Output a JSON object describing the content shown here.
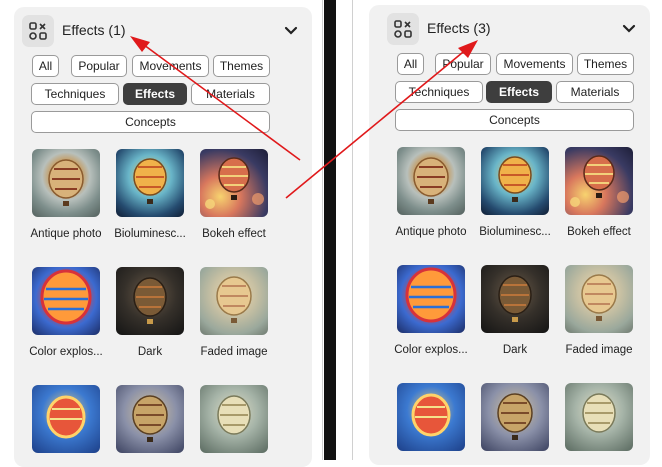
{
  "left_panel": {
    "title": "Effects (1)",
    "filters": [
      {
        "label": "All",
        "selected": false
      },
      {
        "label": "Popular",
        "selected": false
      },
      {
        "label": "Movements",
        "selected": false
      },
      {
        "label": "Themes",
        "selected": false
      },
      {
        "label": "Techniques",
        "selected": false
      },
      {
        "label": "Effects",
        "selected": true
      },
      {
        "label": "Materials",
        "selected": false
      },
      {
        "label": "Concepts",
        "selected": false
      }
    ],
    "items": [
      {
        "label": "Antique photo"
      },
      {
        "label": "Bioluminesc..."
      },
      {
        "label": "Bokeh effect"
      },
      {
        "label": "Color explos..."
      },
      {
        "label": "Dark"
      },
      {
        "label": "Faded image"
      }
    ]
  },
  "right_panel": {
    "title": "Effects (3)",
    "filters": [
      {
        "label": "All",
        "selected": false
      },
      {
        "label": "Popular",
        "selected": false
      },
      {
        "label": "Movements",
        "selected": false
      },
      {
        "label": "Themes",
        "selected": false
      },
      {
        "label": "Techniques",
        "selected": false
      },
      {
        "label": "Effects",
        "selected": true
      },
      {
        "label": "Materials",
        "selected": false
      },
      {
        "label": "Concepts",
        "selected": false
      }
    ],
    "items": [
      {
        "label": "Antique photo"
      },
      {
        "label": "Bioluminesc..."
      },
      {
        "label": "Bokeh effect"
      },
      {
        "label": "Color explos..."
      },
      {
        "label": "Dark"
      },
      {
        "label": "Faded image"
      }
    ]
  },
  "colors": {
    "panel_bg": "#f1f1f1",
    "selected_pill": "#3e3e3e",
    "annotation_arrow": "#e0191b"
  }
}
